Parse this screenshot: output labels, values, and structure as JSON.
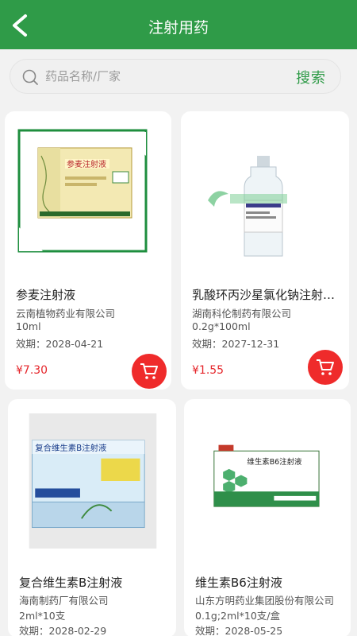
{
  "header": {
    "title": "注射用药"
  },
  "search": {
    "placeholder": "药品名称/厂家",
    "button_label": "搜索"
  },
  "products": [
    {
      "name": "参麦注射液",
      "manufacturer": "云南植物药业有限公司",
      "spec": "10ml",
      "expiry": "效期：2028-04-21",
      "price": "¥7.30",
      "image_brand": "参麦注射液"
    },
    {
      "name": "乳酸环丙沙星氯化钠注射液...",
      "manufacturer": "湖南科伦制药有限公司",
      "spec": "0.2g*100ml",
      "expiry": "效期：2027-12-31",
      "price": "¥1.55"
    },
    {
      "name": "复合维生素B注射液",
      "manufacturer": "海南制药厂有限公司",
      "spec": "2ml*10支",
      "expiry": "效期：2028-02-29",
      "price": "",
      "image_brand": "复合维生素B注射液"
    },
    {
      "name": "维生素B6注射液",
      "manufacturer": "山东方明药业集团股份有限公司",
      "spec": "0.1g;2ml*10支/盒",
      "expiry": "效期：2028-05-25",
      "price": "",
      "image_brand": "维生素B6注射液"
    }
  ],
  "colors": {
    "brand_green": "#2f9b48",
    "price_red": "#e5262b",
    "cart_red": "#ef2b2b"
  }
}
